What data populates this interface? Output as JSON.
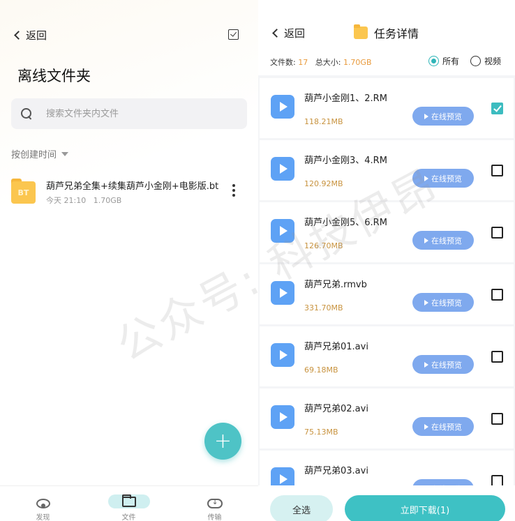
{
  "left": {
    "back_label": "返回",
    "title": "离线文件夹",
    "search_placeholder": "搜索文件夹内文件",
    "sort_label": "按创建时间",
    "file": {
      "icon_text": "BT",
      "name": "葫芦兄弟全集+续集葫芦小金刚+电影版.bt",
      "date": "今天 21:10",
      "size": "1.70GB"
    },
    "fab_label": "+",
    "tabs": [
      {
        "label": "发现",
        "icon": "disc-icon"
      },
      {
        "label": "文件",
        "icon": "folder-icon"
      },
      {
        "label": "传输",
        "icon": "cloud-download-icon"
      }
    ]
  },
  "right": {
    "back_label": "返回",
    "title": "任务详情",
    "stats": {
      "count_label": "文件数:",
      "count": "17",
      "size_label": "总大小:",
      "size": "1.70GB"
    },
    "filters": [
      {
        "label": "所有",
        "selected": true
      },
      {
        "label": "视频",
        "selected": false
      }
    ],
    "preview_label": "在线预览",
    "items": [
      {
        "name": "葫芦小金刚1、2.RM",
        "size": "118.21MB",
        "checked": true
      },
      {
        "name": "葫芦小金刚3、4.RM",
        "size": "120.92MB",
        "checked": false
      },
      {
        "name": "葫芦小金刚5、6.RM",
        "size": "126.70MB",
        "checked": false
      },
      {
        "name": "葫芦兄弟.rmvb",
        "size": "331.70MB",
        "checked": false
      },
      {
        "name": "葫芦兄弟01.avi",
        "size": "69.18MB",
        "checked": false
      },
      {
        "name": "葫芦兄弟02.avi",
        "size": "75.13MB",
        "checked": false
      },
      {
        "name": "葫芦兄弟03.avi",
        "size": "",
        "checked": false
      }
    ],
    "select_all_label": "全选",
    "download_label": "立即下载(1)"
  },
  "watermark": "公众号: 科技伊昂",
  "colors": {
    "accent": "#3ec1c4",
    "size_text": "#c8933f",
    "preview_btn": "#7fa9ee",
    "play_icon": "#5ea2f5"
  }
}
